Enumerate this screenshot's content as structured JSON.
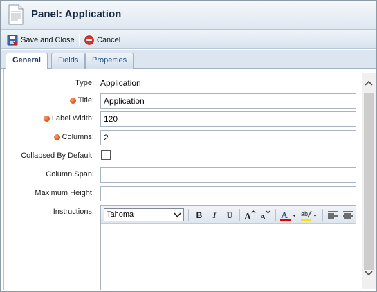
{
  "window": {
    "title": "Panel: Application"
  },
  "toolbar": {
    "save_label": "Save and Close",
    "cancel_label": "Cancel"
  },
  "tabs": [
    {
      "label": "General",
      "active": true
    },
    {
      "label": "Fields",
      "active": false
    },
    {
      "label": "Properties",
      "active": false
    }
  ],
  "form": {
    "type_label": "Type:",
    "type_value": "Application",
    "title_label": "Title:",
    "title_value": "Application",
    "label_width_label": "Label Width:",
    "label_width_value": "120",
    "columns_label": "Columns:",
    "columns_value": "2",
    "collapsed_label": "Collapsed By Default:",
    "collapsed_checked": false,
    "column_span_label": "Column Span:",
    "column_span_value": "",
    "max_height_label": "Maximum Height:",
    "max_height_value": "",
    "instructions_label": "Instructions:"
  },
  "editor": {
    "font_name": "Tahoma",
    "buttons": [
      "bold",
      "italic",
      "underline",
      "grow-font",
      "shrink-font",
      "font-color",
      "highlight",
      "align-left",
      "align-center"
    ],
    "bold_glyph": "B",
    "italic_glyph": "I",
    "underline_glyph": "U",
    "font_color_glyph": "A",
    "highlight_glyph": "ab"
  },
  "colors": {
    "required_dot": "#e0622a",
    "tab_active_text": "#14365c",
    "cancel_icon": "#d9342b",
    "font_color_bar": "#e00000",
    "highlight_bar": "#f5e600"
  }
}
